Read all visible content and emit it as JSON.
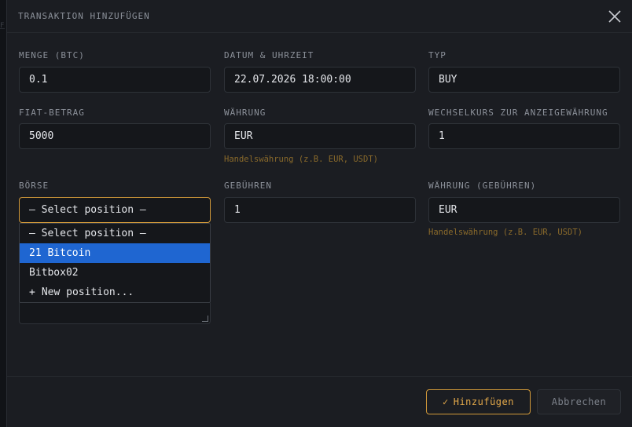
{
  "modal": {
    "title": "TRANSAKTION HINZUFÜGEN"
  },
  "fields": {
    "menge_label": "MENGE (BTC)",
    "menge_value": "0.1",
    "datum_label": "DATUM & UHRZEIT",
    "datum_value": "22.07.2026 18:00:00",
    "typ_label": "TYP",
    "typ_value": "BUY",
    "fiat_label": "FIAT-BETRAG",
    "fiat_value": "5000",
    "waehrung_label": "WÄHRUNG",
    "waehrung_value": "EUR",
    "waehrung_hint": "Handelswährung (z.B. EUR, USDT)",
    "kurs_label": "WECHSELKURS ZUR ANZEIGEWÄHRUNG",
    "kurs_value": "1",
    "boerse_label": "BÖRSE",
    "boerse_value": "— Select position —",
    "gebuehren_label": "GEBÜHREN",
    "gebuehren_value": "1",
    "fee_currency_label": "WÄHRUNG (GEBÜHREN)",
    "fee_currency_value": "EUR",
    "fee_currency_hint": "Handelswährung (z.B. EUR, USDT)"
  },
  "dropdown": {
    "options": [
      "— Select position —",
      "21 Bitcoin",
      "Bitbox02",
      "New position..."
    ],
    "selected_index": 1,
    "new_icon": "plus-icon"
  },
  "footer": {
    "primary_label": "Hinzufügen",
    "secondary_label": "Abbrechen"
  },
  "colors": {
    "accent": "#d39a3a",
    "selection": "#1f66d1",
    "background": "#1b1d22"
  }
}
